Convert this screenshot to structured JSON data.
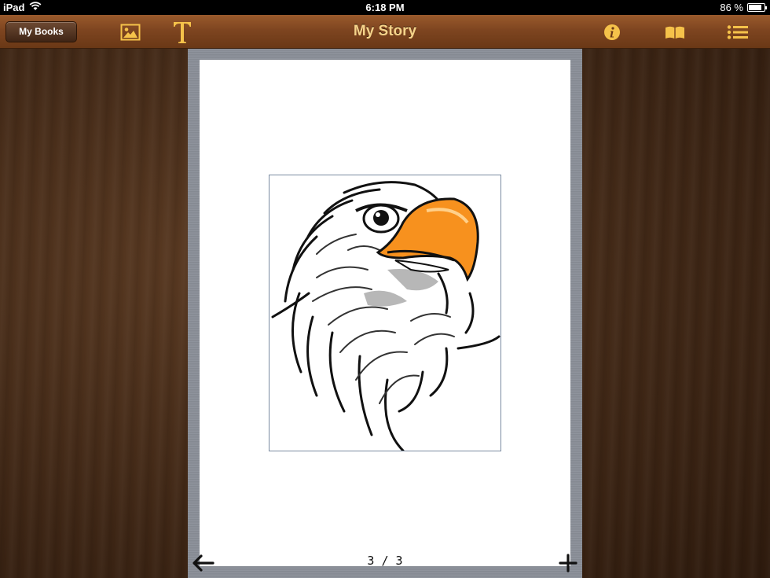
{
  "status_bar": {
    "device": "iPad",
    "time": "6:18 PM",
    "battery": "86 %",
    "battery_level": 0.86
  },
  "toolbar": {
    "my_books_label": "My Books",
    "title": "My Story",
    "icons": {
      "add_image": "image-icon",
      "add_text": "text-icon",
      "info": "info-icon",
      "preview": "book-icon",
      "pages": "list-icon"
    },
    "accent_color": "#f5c24a"
  },
  "page": {
    "indicator": "3 / 3",
    "image_name": "eagle-head-illustration"
  },
  "footer_icons": {
    "back": "arrow-left-icon",
    "add": "plus-icon"
  }
}
